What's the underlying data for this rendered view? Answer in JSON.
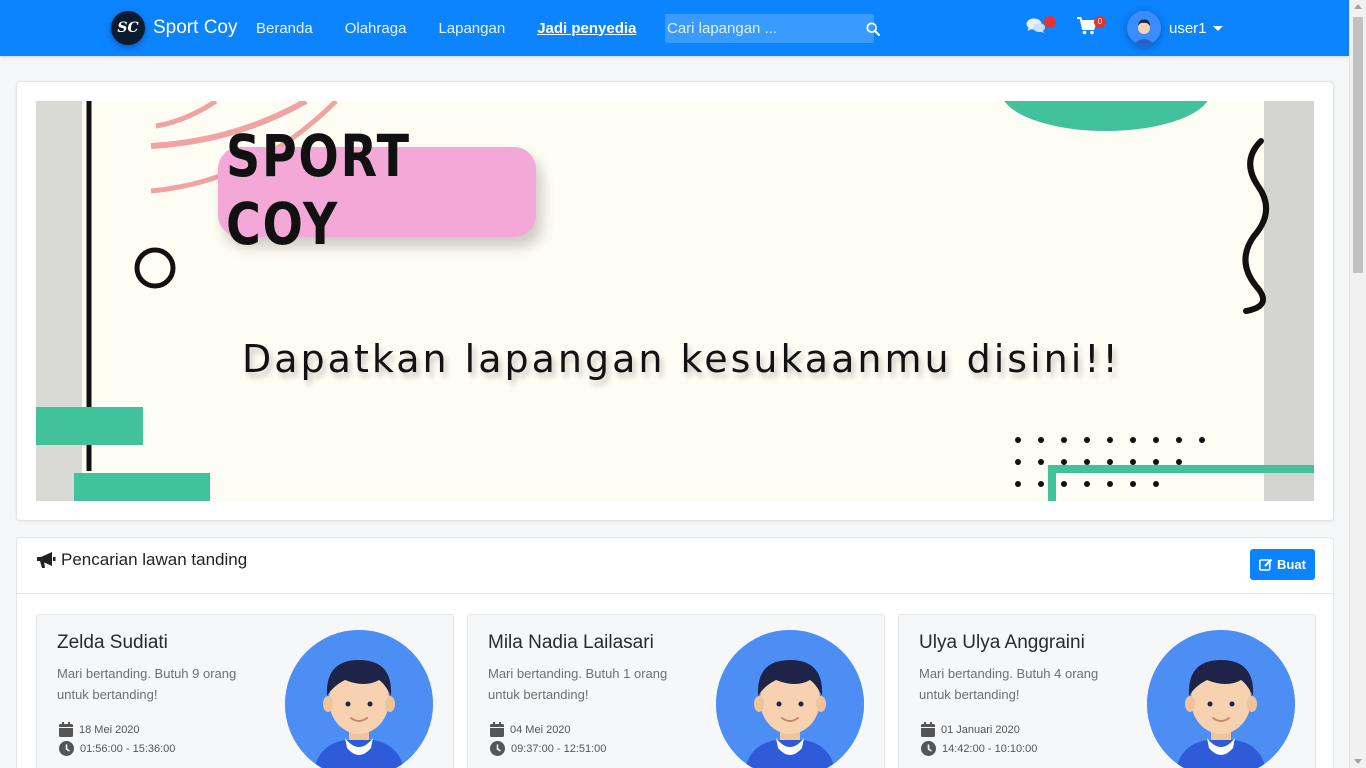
{
  "navbar": {
    "brand_logo": "SC",
    "brand_name": "Sport Coy",
    "links": [
      {
        "label": "Beranda",
        "active": false
      },
      {
        "label": "Olahraga",
        "active": false
      },
      {
        "label": "Lapangan",
        "active": false
      },
      {
        "label": "Jadi penyedia",
        "active": true
      }
    ],
    "search_placeholder": "Cari lapangan ...",
    "cart_count": "0",
    "username": "user1",
    "accent_color": "#0c83ff",
    "badge_color": "#e3342f"
  },
  "banner": {
    "title": "SPORT COY",
    "tagline": "Dapatkan lapangan kesukaanmu disini!!"
  },
  "matches": {
    "title": "Pencarian lawan tanding",
    "create_label": "Buat",
    "items": [
      {
        "name": "Zelda Sudiati",
        "desc": "Mari bertanding. Butuh 9 orang untuk bertanding!",
        "date": "18 Mei 2020",
        "time": "01:56:00 - 15:36:00"
      },
      {
        "name": "Mila Nadia Lailasari",
        "desc": "Mari bertanding. Butuh 1 orang untuk bertanding!",
        "date": "04 Mei 2020",
        "time": "09:37:00 - 12:51:00"
      },
      {
        "name": "Ulya Ulya Anggraini",
        "desc": "Mari bertanding. Butuh 4 orang untuk bertanding!",
        "date": "01 Januari 2020",
        "time": "14:42:00 - 10:10:00"
      }
    ]
  },
  "icons": {
    "search": "search-icon",
    "chat": "chat-icon",
    "cart": "cart-icon",
    "megaphone": "megaphone-icon",
    "edit": "edit-icon",
    "calendar": "calendar-icon",
    "clock": "clock-icon"
  }
}
